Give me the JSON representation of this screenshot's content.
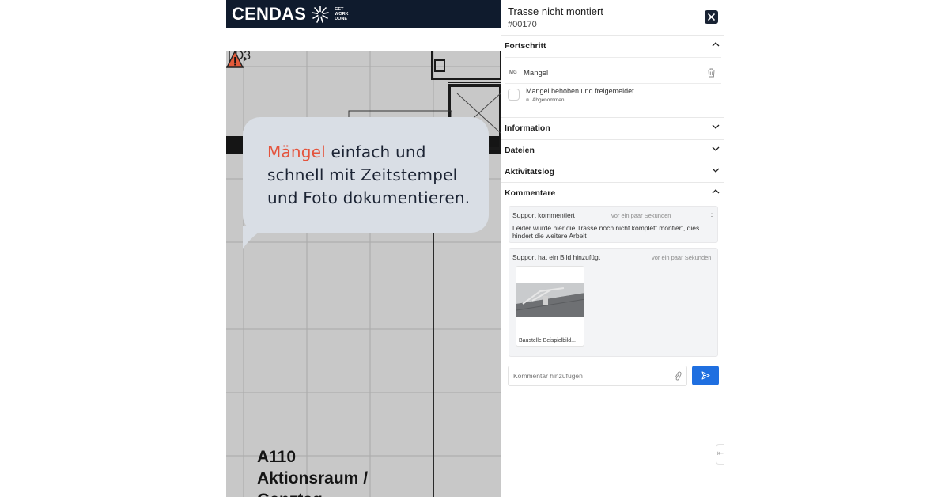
{
  "brand": {
    "logo_text": "CENDAS",
    "tagline": [
      "GET",
      "WORK",
      "DONE"
    ]
  },
  "plan": {
    "section_label": "| D3",
    "room_label": [
      "A110",
      "Aktionsraum /",
      "Ganztag"
    ]
  },
  "promo": {
    "accent_word": "Mängel",
    "line1_rest": " einfach und",
    "line2": "schnell mit Zeitstempel",
    "line3": "und Foto dokumentieren.",
    "accent_color": "#e4533c"
  },
  "panel": {
    "title": "Trasse nicht montiert",
    "number": "#00170",
    "close_icon": "close-icon",
    "sections": {
      "fortschritt": "Fortschritt",
      "information": "Information",
      "dateien": "Dateien",
      "aktivitaetslog": "Aktivitätslog",
      "kommentare": "Kommentare"
    },
    "progress": {
      "badge": "MG",
      "item_label": "Mangel",
      "checkbox_label": "Mangel behoben und freigemeldet",
      "checkbox_sub": "Abgenommen",
      "checked": false
    },
    "comments": [
      {
        "who": "Support kommentiert",
        "time": "vor ein paar Sekunden",
        "text": "Leider wurde hier die Trasse noch nicht komplett montiert, dies hindert die weitere Arbeit"
      },
      {
        "who": "Support hat ein Bild hinzufügt",
        "time": "vor ein paar Sekunden",
        "attachment_caption": "Baustelle Beispielbild..."
      }
    ],
    "comment_input": {
      "placeholder": "Kommentar hinzufügen"
    },
    "accent_color": "#1f6fe0"
  }
}
